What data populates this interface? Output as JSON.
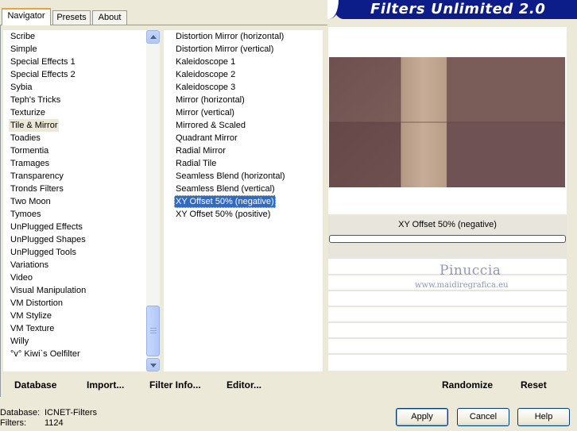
{
  "app": {
    "title": "Filters Unlimited 2.0"
  },
  "tabs": [
    {
      "label": "Navigator",
      "active": true
    },
    {
      "label": "Presets",
      "active": false
    },
    {
      "label": "About",
      "active": false
    }
  ],
  "categories": {
    "items": [
      "Scribe",
      "Simple",
      "Special Effects 1",
      "Special Effects 2",
      "Sybia",
      "Teph's Tricks",
      "Texturize",
      "Tile & Mirror",
      "Toadies",
      "Tormentia",
      "Tramages",
      "Transparency",
      "Tronds Filters",
      "Two Moon",
      "Tymoes",
      "UnPlugged Effects",
      "UnPlugged Shapes",
      "UnPlugged Tools",
      "Variations",
      "Video",
      "Visual Manipulation",
      "VM Distortion",
      "VM Stylize",
      "VM Texture",
      "Willy",
      "°v° Kiwi`s Oelfilter"
    ],
    "selected": "Tile & Mirror"
  },
  "filters": {
    "items": [
      "Distortion Mirror (horizontal)",
      "Distortion Mirror (vertical)",
      "Kaleidoscope 1",
      "Kaleidoscope 2",
      "Kaleidoscope 3",
      "Mirror (horizontal)",
      "Mirror (vertical)",
      "Mirrored & Scaled",
      "Quadrant Mirror",
      "Radial Mirror",
      "Radial Tile",
      "Seamless Blend (horizontal)",
      "Seamless Blend (vertical)",
      "XY Offset 50% (negative)",
      "XY Offset 50% (positive)"
    ],
    "selected": "XY Offset 50% (negative)"
  },
  "toolbar": {
    "database_label": "Database",
    "import_label": "Import...",
    "filter_info_label": "Filter Info...",
    "editor_label": "Editor...",
    "randomize_label": "Randomize",
    "reset_label": "Reset"
  },
  "preview": {
    "filter_name": "XY Offset 50% (negative)",
    "watermark_title": "Pinuccia",
    "watermark_url": "www.maidiregrafica.eu",
    "colors": {
      "dark": "#6e5050",
      "mid": "#7d605a",
      "light": "#c0a58f"
    }
  },
  "info": {
    "database_label": "Database:",
    "database_value": "ICNET-Filters",
    "filters_label": "Filters:",
    "filters_value": "1124"
  },
  "buttons": {
    "apply": "Apply",
    "cancel": "Cancel",
    "help": "Help"
  }
}
